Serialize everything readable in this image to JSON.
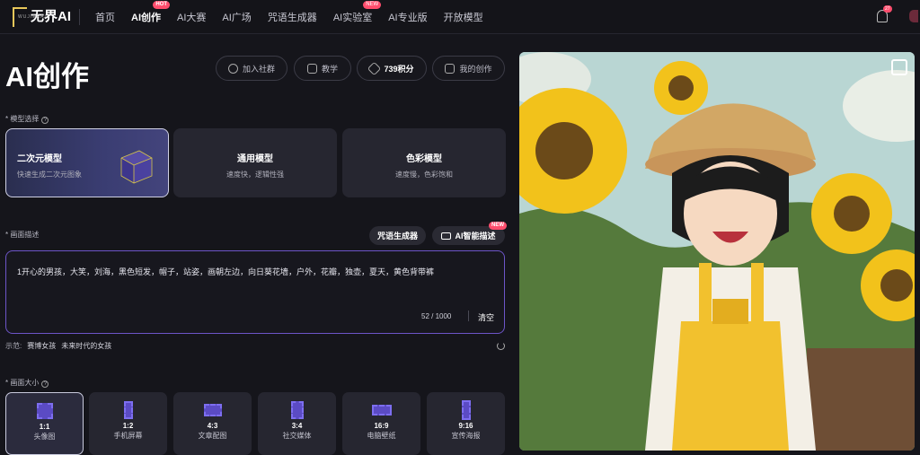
{
  "brand": {
    "name": "无界AI",
    "tagline": "WUJIERAI"
  },
  "nav": {
    "items": [
      {
        "label": "首页",
        "active": false
      },
      {
        "label": "AI创作",
        "active": true,
        "badge": "HOT"
      },
      {
        "label": "AI大赛",
        "active": false
      },
      {
        "label": "AI广场",
        "active": false
      },
      {
        "label": "咒语生成器",
        "active": false
      },
      {
        "label": "AI实验室",
        "active": false,
        "badge": "NEW"
      },
      {
        "label": "AI专业版",
        "active": false
      },
      {
        "label": "开放模型",
        "active": false
      }
    ],
    "notifications": "27"
  },
  "page": {
    "title": "AI创作",
    "actions": [
      {
        "label": "加入社群",
        "icon": "chat-icon"
      },
      {
        "label": "教学",
        "icon": "book-icon"
      },
      {
        "label": "739积分",
        "icon": "points-icon"
      },
      {
        "label": "我的创作",
        "icon": "folder-icon"
      }
    ]
  },
  "model": {
    "label": "模型选择",
    "cards": [
      {
        "title": "二次元模型",
        "sub": "快速生成二次元图象",
        "selected": true
      },
      {
        "title": "通用模型",
        "sub": "速度快，逻辑性强",
        "selected": false
      },
      {
        "title": "色彩模型",
        "sub": "速度慢，色彩饱和",
        "selected": false
      }
    ]
  },
  "prompt": {
    "label": "画面描述",
    "spell_btn": "咒语生成器",
    "ai_btn": "AI智能描述",
    "ai_badge": "NEW",
    "text": "1开心的男孩，大笑，刘海，黑色短发，帽子，站姿，画朝左边，向日葵花墙，户外，花瓣，独壶，夏天，黄色背带裤",
    "count": "52 / 1000",
    "clear": "清空"
  },
  "examples": {
    "label": "示范:",
    "items": [
      "赛博女孩",
      "未来时代的女孩"
    ]
  },
  "size": {
    "label": "画面大小",
    "options": [
      {
        "ratio": "1:1",
        "name": "头像图",
        "selected": true
      },
      {
        "ratio": "1:2",
        "name": "手机屏幕",
        "selected": false
      },
      {
        "ratio": "4:3",
        "name": "文章配图",
        "selected": false
      },
      {
        "ratio": "3:4",
        "name": "社交媒体",
        "selected": false
      },
      {
        "ratio": "16:9",
        "name": "电脑壁纸",
        "selected": false
      },
      {
        "ratio": "9:16",
        "name": "宣传海报",
        "selected": false
      }
    ]
  },
  "colors": {
    "accent": "#6d55c8",
    "hot": "#ff4d6d",
    "bg": "#15151b"
  }
}
